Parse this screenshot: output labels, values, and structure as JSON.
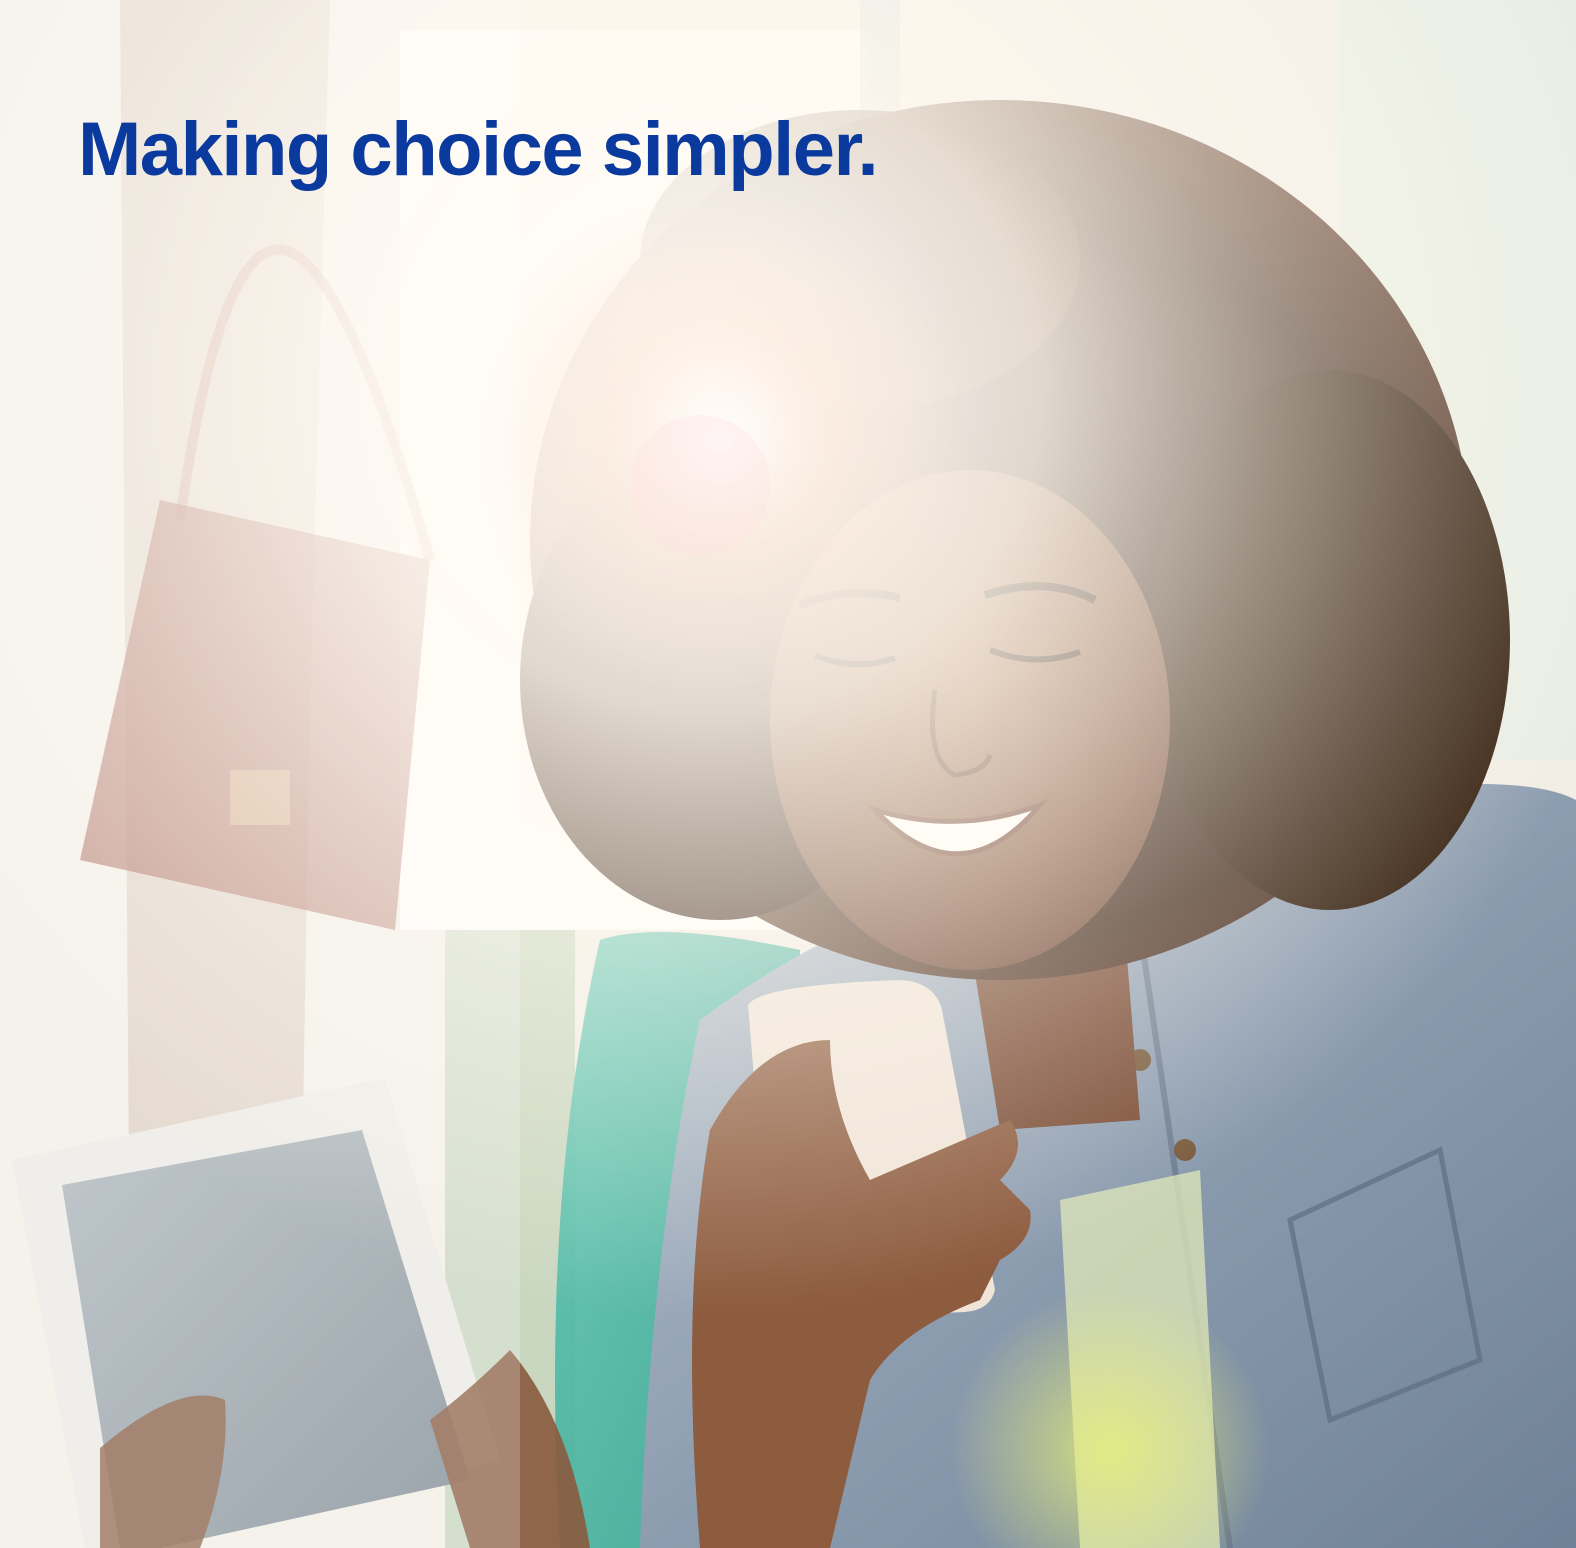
{
  "headline": {
    "text": "Making choice simpler.",
    "color": "#0a3a9e"
  },
  "photo": {
    "subject": "smiling woman with curly hair looking at a smartphone and holding a tablet, sunlit window behind",
    "colors": {
      "window_light": "#ffffff",
      "curtain": "#c9b9a8",
      "bag": "#a35c4f",
      "hair": "#3a2216",
      "skin": "#8a5a3e",
      "denim": "#8a9bb0",
      "teal_chair": "#3fb7a3",
      "phone": "#f0e4d8",
      "tablet_frame": "#ece9e4",
      "tablet_screen": "#9eaab2",
      "flare": "#fff6e8"
    }
  }
}
